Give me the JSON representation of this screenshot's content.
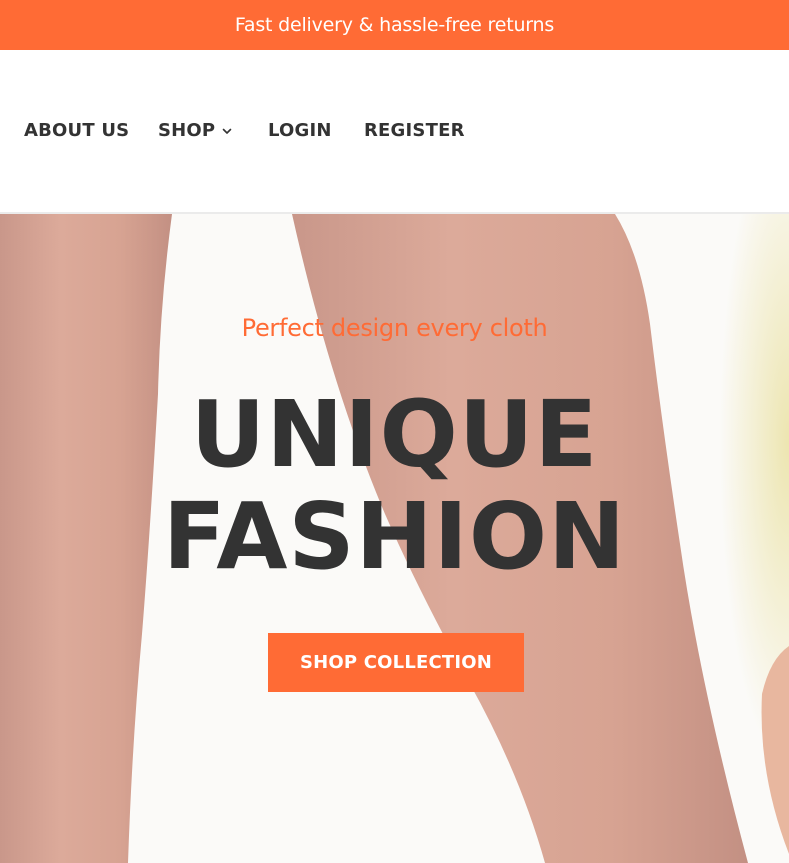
{
  "announcement": {
    "text": "Fast delivery & hassle-free returns"
  },
  "nav": {
    "items": [
      {
        "label": "ABOUT US"
      },
      {
        "label": "SHOP",
        "icon": "chevron-down-icon"
      },
      {
        "label": "LOGIN"
      },
      {
        "label": "REGISTER"
      }
    ]
  },
  "hero": {
    "tagline": "Perfect design every cloth",
    "headline_line1": "UNIQUE",
    "headline_line2": "FASHION",
    "cta_label": "SHOP COLLECTION"
  },
  "colors": {
    "accent": "#ff6b35",
    "text_dark": "#333333",
    "background": "#ffffff"
  }
}
